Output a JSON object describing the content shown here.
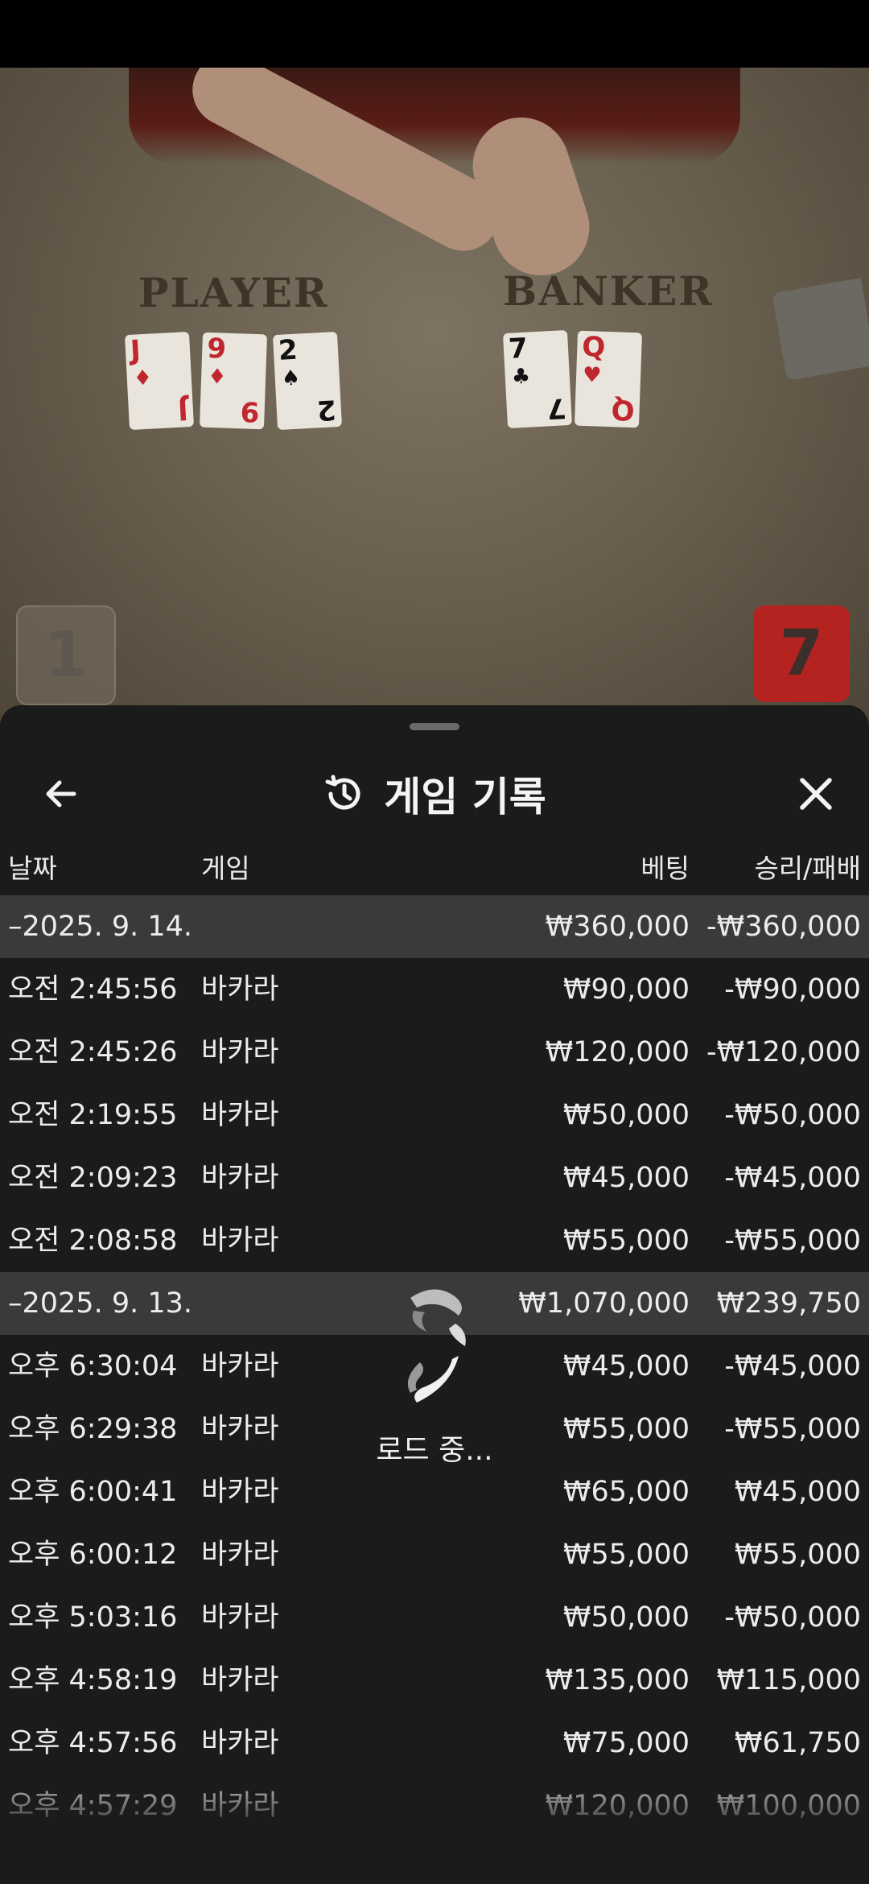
{
  "video": {
    "player_label": "PLAYER",
    "banker_label": "BANKER",
    "player_cards": [
      {
        "rank": "J",
        "suit": "♦",
        "color": "red"
      },
      {
        "rank": "9",
        "suit": "♦",
        "color": "red"
      },
      {
        "rank": "2",
        "suit": "♠",
        "color": "blk"
      }
    ],
    "banker_cards": [
      {
        "rank": "7",
        "suit": "♣",
        "color": "blk"
      },
      {
        "rank": "Q",
        "suit": "♥",
        "color": "red"
      }
    ],
    "player_score": "1",
    "banker_score": "7"
  },
  "sheet": {
    "title": "게임 기록",
    "back_icon": "←",
    "close_icon": "✕",
    "columns": {
      "date": "날짜",
      "game": "게임",
      "bet": "베팅",
      "result": "승리/패배"
    },
    "loading_text": "로드 중...",
    "rows": [
      {
        "type": "group",
        "date": "–2025. 9. 14.",
        "game": "",
        "bet": "₩360,000",
        "result": "-₩360,000"
      },
      {
        "type": "item",
        "date": "오전 2:45:56",
        "game": "바카라",
        "bet": "₩90,000",
        "result": "-₩90,000"
      },
      {
        "type": "item",
        "date": "오전 2:45:26",
        "game": "바카라",
        "bet": "₩120,000",
        "result": "-₩120,000"
      },
      {
        "type": "item",
        "date": "오전 2:19:55",
        "game": "바카라",
        "bet": "₩50,000",
        "result": "-₩50,000"
      },
      {
        "type": "item",
        "date": "오전 2:09:23",
        "game": "바카라",
        "bet": "₩45,000",
        "result": "-₩45,000"
      },
      {
        "type": "item",
        "date": "오전 2:08:58",
        "game": "바카라",
        "bet": "₩55,000",
        "result": "-₩55,000"
      },
      {
        "type": "group",
        "date": "–2025. 9. 13.",
        "game": "",
        "bet": "₩1,070,000",
        "result": "₩239,750"
      },
      {
        "type": "item",
        "date": "오후 6:30:04",
        "game": "바카라",
        "bet": "₩45,000",
        "result": "-₩45,000"
      },
      {
        "type": "item",
        "date": "오후 6:29:38",
        "game": "바카라",
        "bet": "₩55,000",
        "result": "-₩55,000"
      },
      {
        "type": "item",
        "date": "오후 6:00:41",
        "game": "바카라",
        "bet": "₩65,000",
        "result": "₩45,000"
      },
      {
        "type": "item",
        "date": "오후 6:00:12",
        "game": "바카라",
        "bet": "₩55,000",
        "result": "₩55,000"
      },
      {
        "type": "item",
        "date": "오후 5:03:16",
        "game": "바카라",
        "bet": "₩50,000",
        "result": "-₩50,000"
      },
      {
        "type": "item",
        "date": "오후 4:58:19",
        "game": "바카라",
        "bet": "₩135,000",
        "result": "₩115,000"
      },
      {
        "type": "item",
        "date": "오후 4:57:56",
        "game": "바카라",
        "bet": "₩75,000",
        "result": "₩61,750"
      },
      {
        "type": "item",
        "date": "오후 4:57:29",
        "game": "바카라",
        "bet": "₩120,000",
        "result": "₩100,000"
      }
    ]
  },
  "colors": {
    "sheet_bg": "#1b1b1b",
    "group_row_bg": "#3a3a3a",
    "banker_score_bg": "#b42320"
  }
}
